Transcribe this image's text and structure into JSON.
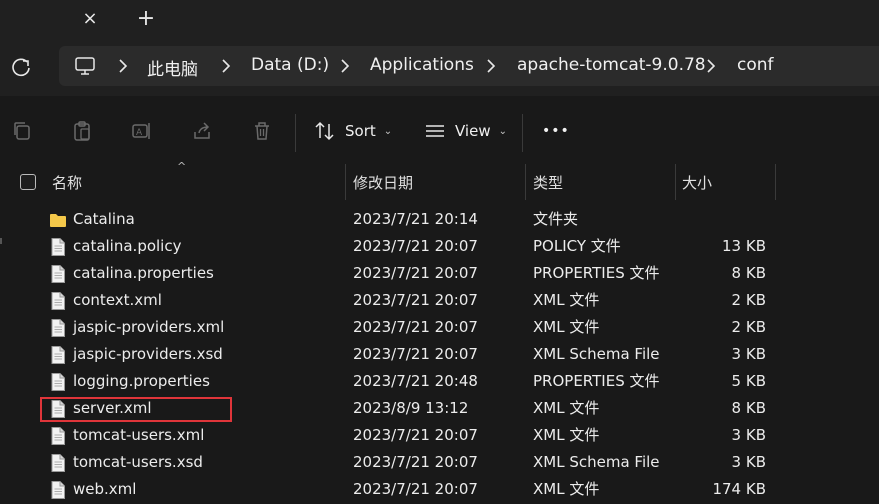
{
  "tabstrip": {
    "close_icon": "×",
    "add_icon": "+"
  },
  "address": {
    "crumbs": [
      "此电脑",
      "Data (D:)",
      "Applications",
      "apache-tomcat-9.0.78",
      "conf"
    ]
  },
  "toolbar": {
    "sort_label": "Sort",
    "view_label": "View",
    "more_label": "•••"
  },
  "columns": {
    "name": "名称",
    "date": "修改日期",
    "type": "类型",
    "size": "大小"
  },
  "files": [
    {
      "icon": "folder-icon",
      "name": "Catalina",
      "date": "2023/7/21 20:14",
      "type": "文件夹",
      "size": ""
    },
    {
      "icon": "file-icon",
      "name": "catalina.policy",
      "date": "2023/7/21 20:07",
      "type": "POLICY 文件",
      "size": "13 KB"
    },
    {
      "icon": "file-icon",
      "name": "catalina.properties",
      "date": "2023/7/21 20:07",
      "type": "PROPERTIES 文件",
      "size": "8 KB"
    },
    {
      "icon": "file-icon",
      "name": "context.xml",
      "date": "2023/7/21 20:07",
      "type": "XML 文件",
      "size": "2 KB"
    },
    {
      "icon": "file-icon",
      "name": "jaspic-providers.xml",
      "date": "2023/7/21 20:07",
      "type": "XML 文件",
      "size": "2 KB"
    },
    {
      "icon": "file-icon",
      "name": "jaspic-providers.xsd",
      "date": "2023/7/21 20:07",
      "type": "XML Schema File",
      "size": "3 KB"
    },
    {
      "icon": "file-icon",
      "name": "logging.properties",
      "date": "2023/7/21 20:48",
      "type": "PROPERTIES 文件",
      "size": "5 KB"
    },
    {
      "icon": "file-icon",
      "name": "server.xml",
      "date": "2023/8/9 13:12",
      "type": "XML 文件",
      "size": "8 KB"
    },
    {
      "icon": "file-icon",
      "name": "tomcat-users.xml",
      "date": "2023/7/21 20:07",
      "type": "XML 文件",
      "size": "3 KB"
    },
    {
      "icon": "file-icon",
      "name": "tomcat-users.xsd",
      "date": "2023/7/21 20:07",
      "type": "XML Schema File",
      "size": "3 KB"
    },
    {
      "icon": "file-icon",
      "name": "web.xml",
      "date": "2023/7/21 20:07",
      "type": "XML 文件",
      "size": "174 KB"
    }
  ],
  "colors": {
    "background": "#191919",
    "chrome": "#202020",
    "address_box": "#2b2b2b",
    "folder": "#f4c84a",
    "highlight": "#e0353a"
  }
}
